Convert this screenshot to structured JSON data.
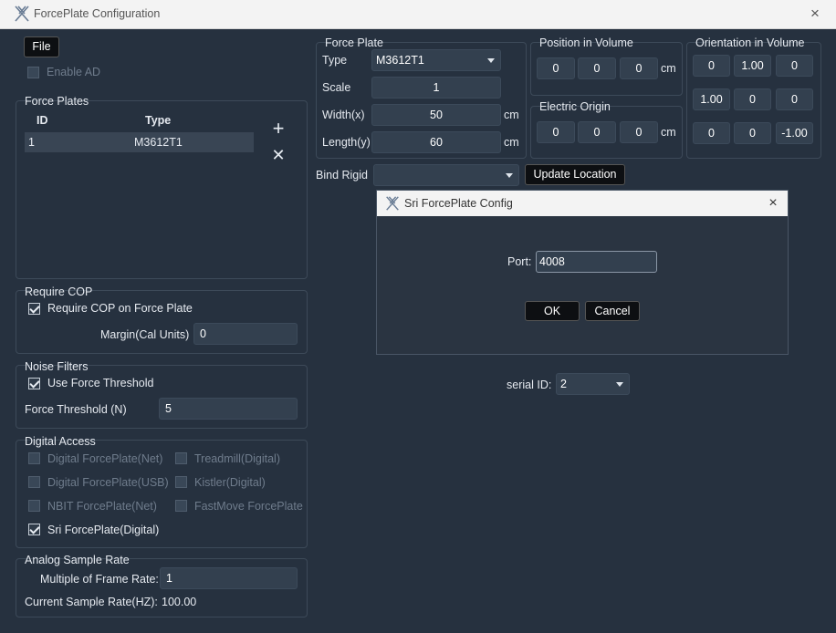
{
  "window": {
    "title": "ForcePlate Configuration",
    "close_icon": "×"
  },
  "file_menu": {
    "label": "File"
  },
  "enable_ad": {
    "label": "Enable AD",
    "checked": false,
    "enabled": false
  },
  "force_plates": {
    "title": "Force Plates",
    "columns": [
      "ID",
      "Type"
    ],
    "rows": [
      {
        "id": "1",
        "type": "M3612T1"
      }
    ],
    "add_icon": "+",
    "remove_icon": "✕"
  },
  "require_cop": {
    "title": "Require COP",
    "checkbox_label": "Require COP on Force Plate",
    "checked": true,
    "margin_label": "Margin(Cal Units)",
    "margin_value": "0"
  },
  "noise_filters": {
    "title": "Noise Filters",
    "checkbox_label": "Use Force Threshold",
    "checked": true,
    "threshold_label": "Force Threshold (N)",
    "threshold_value": "5"
  },
  "digital_access": {
    "title": "Digital Access",
    "options": [
      {
        "label": "Digital ForcePlate(Net)",
        "checked": false,
        "enabled": false
      },
      {
        "label": "Treadmill(Digital)",
        "checked": false,
        "enabled": false
      },
      {
        "label": "Digital ForcePlate(USB)",
        "checked": false,
        "enabled": false
      },
      {
        "label": "Kistler(Digital)",
        "checked": false,
        "enabled": false
      },
      {
        "label": "NBIT ForcePlate(Net)",
        "checked": false,
        "enabled": false
      },
      {
        "label": "FastMove ForcePlate",
        "checked": false,
        "enabled": false
      },
      {
        "label": "Sri ForcePlate(Digital)",
        "checked": true,
        "enabled": true
      }
    ]
  },
  "analog_sample_rate": {
    "title": "Analog Sample Rate",
    "multiple_label": "Multiple of Frame Rate:",
    "multiple_value": "1",
    "current_label": "Current Sample Rate(HZ):",
    "current_value": "100.00"
  },
  "force_plate": {
    "title": "Force Plate",
    "type_label": "Type",
    "type_value": "M3612T1",
    "scale_label": "Scale",
    "scale_value": "1",
    "width_label": "Width(x)",
    "width_value": "50",
    "length_label": "Length(y)",
    "length_value": "60",
    "unit": "cm"
  },
  "position_in_volume": {
    "title": "Position in Volume",
    "values": [
      "0",
      "0",
      "0"
    ],
    "unit": "cm"
  },
  "electric_origin": {
    "title": "Electric Origin",
    "values": [
      "0",
      "0",
      "0"
    ],
    "unit": "cm"
  },
  "orientation_in_volume": {
    "title": "Orientation in Volume",
    "rows": [
      [
        "0",
        "1.00",
        "0"
      ],
      [
        "1.00",
        "0",
        "0"
      ],
      [
        "0",
        "0",
        "-1.00"
      ]
    ]
  },
  "bind_rigid": {
    "label": "Bind Rigid",
    "value": "",
    "update_button": "Update Location"
  },
  "serial": {
    "label": "serial ID:",
    "value": "2"
  },
  "sri_dialog": {
    "title": "Sri ForcePlate Config",
    "close_icon": "×",
    "port_label": "Port:",
    "port_value": "4008",
    "ok_label": "OK",
    "cancel_label": "Cancel"
  }
}
